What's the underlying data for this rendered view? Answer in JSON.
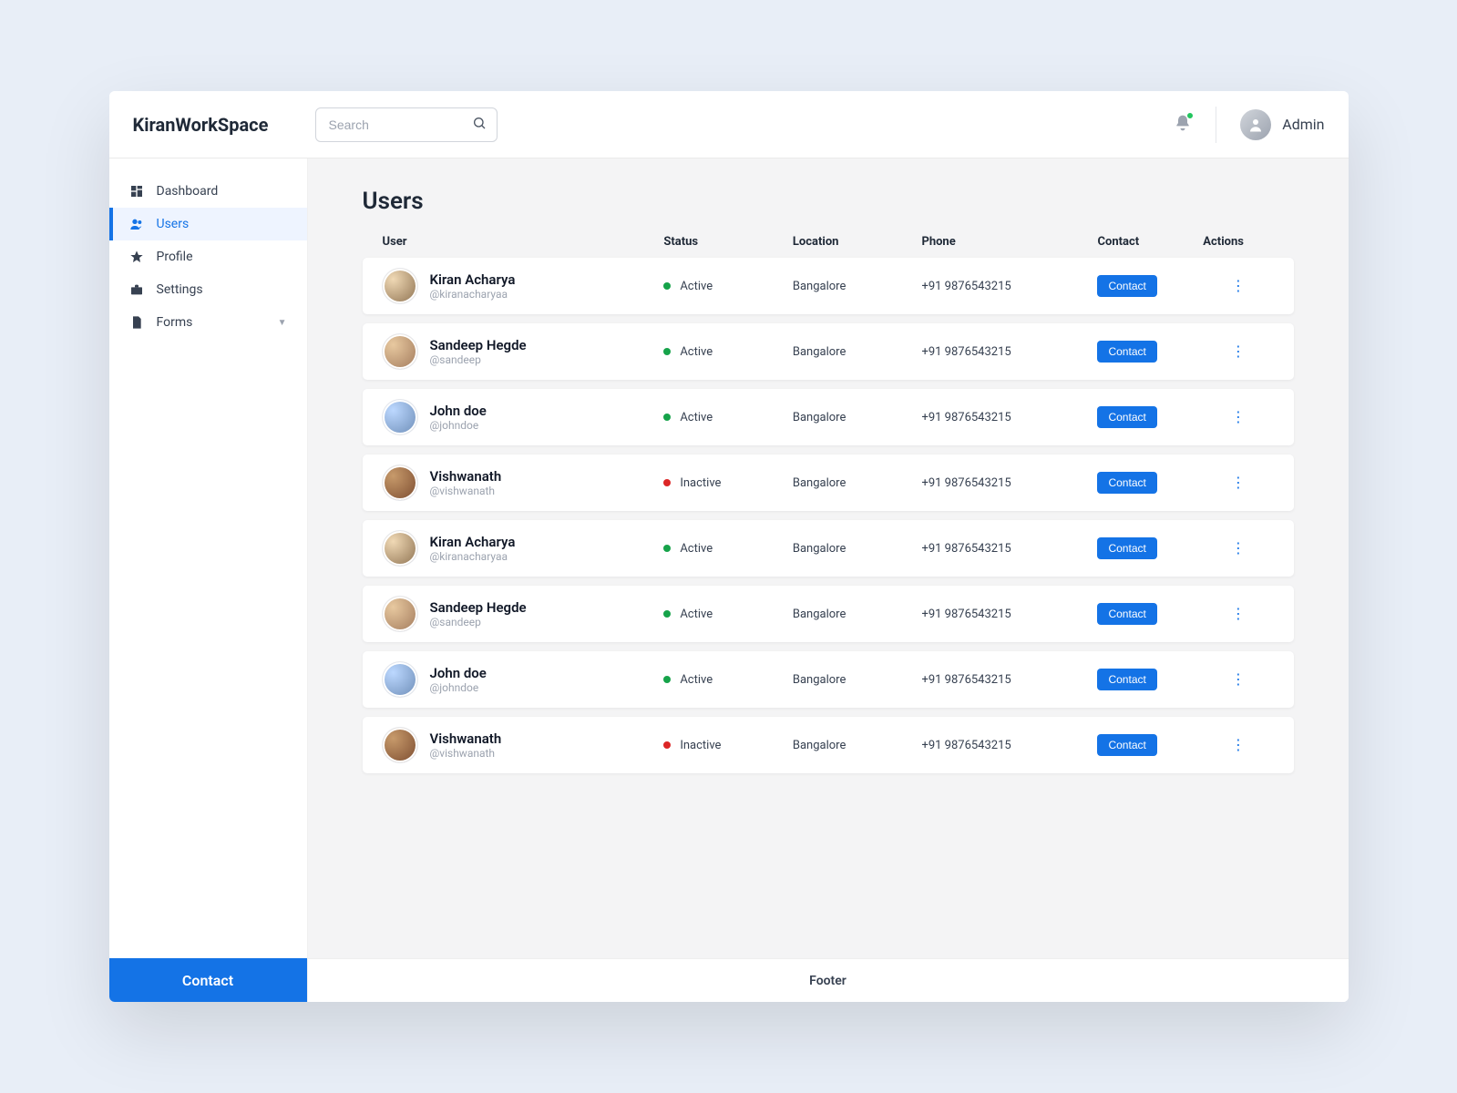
{
  "brand": "KiranWorkSpace",
  "search": {
    "placeholder": "Search"
  },
  "topuser": {
    "name": "Admin"
  },
  "sidebar": {
    "items": [
      {
        "label": "Dashboard"
      },
      {
        "label": "Users"
      },
      {
        "label": "Profile"
      },
      {
        "label": "Settings"
      },
      {
        "label": "Forms"
      }
    ],
    "footer_label": "Contact"
  },
  "page": {
    "title": "Users"
  },
  "columns": {
    "user": "User",
    "status": "Status",
    "location": "Location",
    "phone": "Phone",
    "contact": "Contact",
    "actions": "Actions"
  },
  "status_labels": {
    "active": "Active",
    "inactive": "Inactive"
  },
  "contact_button": "Contact",
  "footer_text": "Footer",
  "users": [
    {
      "name": "Kiran Acharya",
      "handle": "@kiranacharyaa",
      "status": "active",
      "location": "Bangalore",
      "phone": "+91 9876543215",
      "avatar": "a1"
    },
    {
      "name": "Sandeep Hegde",
      "handle": "@sandeep",
      "status": "active",
      "location": "Bangalore",
      "phone": "+91 9876543215",
      "avatar": "a2"
    },
    {
      "name": "John doe",
      "handle": "@johndoe",
      "status": "active",
      "location": "Bangalore",
      "phone": "+91 9876543215",
      "avatar": "a3"
    },
    {
      "name": "Vishwanath",
      "handle": "@vishwanath",
      "status": "inactive",
      "location": "Bangalore",
      "phone": "+91 9876543215",
      "avatar": "a4"
    },
    {
      "name": "Kiran Acharya",
      "handle": "@kiranacharyaa",
      "status": "active",
      "location": "Bangalore",
      "phone": "+91 9876543215",
      "avatar": "a1"
    },
    {
      "name": "Sandeep Hegde",
      "handle": "@sandeep",
      "status": "active",
      "location": "Bangalore",
      "phone": "+91 9876543215",
      "avatar": "a2"
    },
    {
      "name": "John doe",
      "handle": "@johndoe",
      "status": "active",
      "location": "Bangalore",
      "phone": "+91 9876543215",
      "avatar": "a3"
    },
    {
      "name": "Vishwanath",
      "handle": "@vishwanath",
      "status": "inactive",
      "location": "Bangalore",
      "phone": "+91 9876543215",
      "avatar": "a4"
    }
  ]
}
